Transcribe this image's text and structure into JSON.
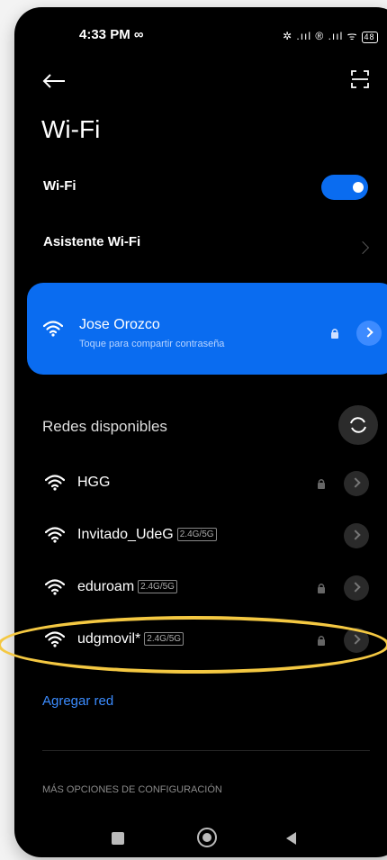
{
  "status_bar": {
    "time": "4:33 PM ∞",
    "indicators": "✲ .ııl ® .ııl ᯤ",
    "battery": "48"
  },
  "header": {
    "back_icon": "arrow-left-icon",
    "scan_icon": "qr-scan-icon",
    "title": "Wi-Fi"
  },
  "wifi_toggle": {
    "label": "Wi-Fi",
    "enabled": true
  },
  "assistant": {
    "label": "Asistente Wi-Fi"
  },
  "connected": {
    "name": "Jose Orozco",
    "subtitle": "Toque para compartir contraseña",
    "accent": "#0a6cf0"
  },
  "available": {
    "heading": "Redes disponibles",
    "networks": [
      {
        "name": "HGG",
        "band": "",
        "locked": true
      },
      {
        "name": "Invitado_UdeG",
        "band": "2.4G/5G",
        "locked": false
      },
      {
        "name": "eduroam",
        "band": "2.4G/5G",
        "locked": true
      },
      {
        "name": "udgmovil*",
        "band": "2.4G/5G",
        "locked": true
      }
    ]
  },
  "add_network": "Agregar red",
  "more_options": "MÁS OPCIONES DE CONFIGURACIÓN",
  "highlight_color": "#f4c842"
}
